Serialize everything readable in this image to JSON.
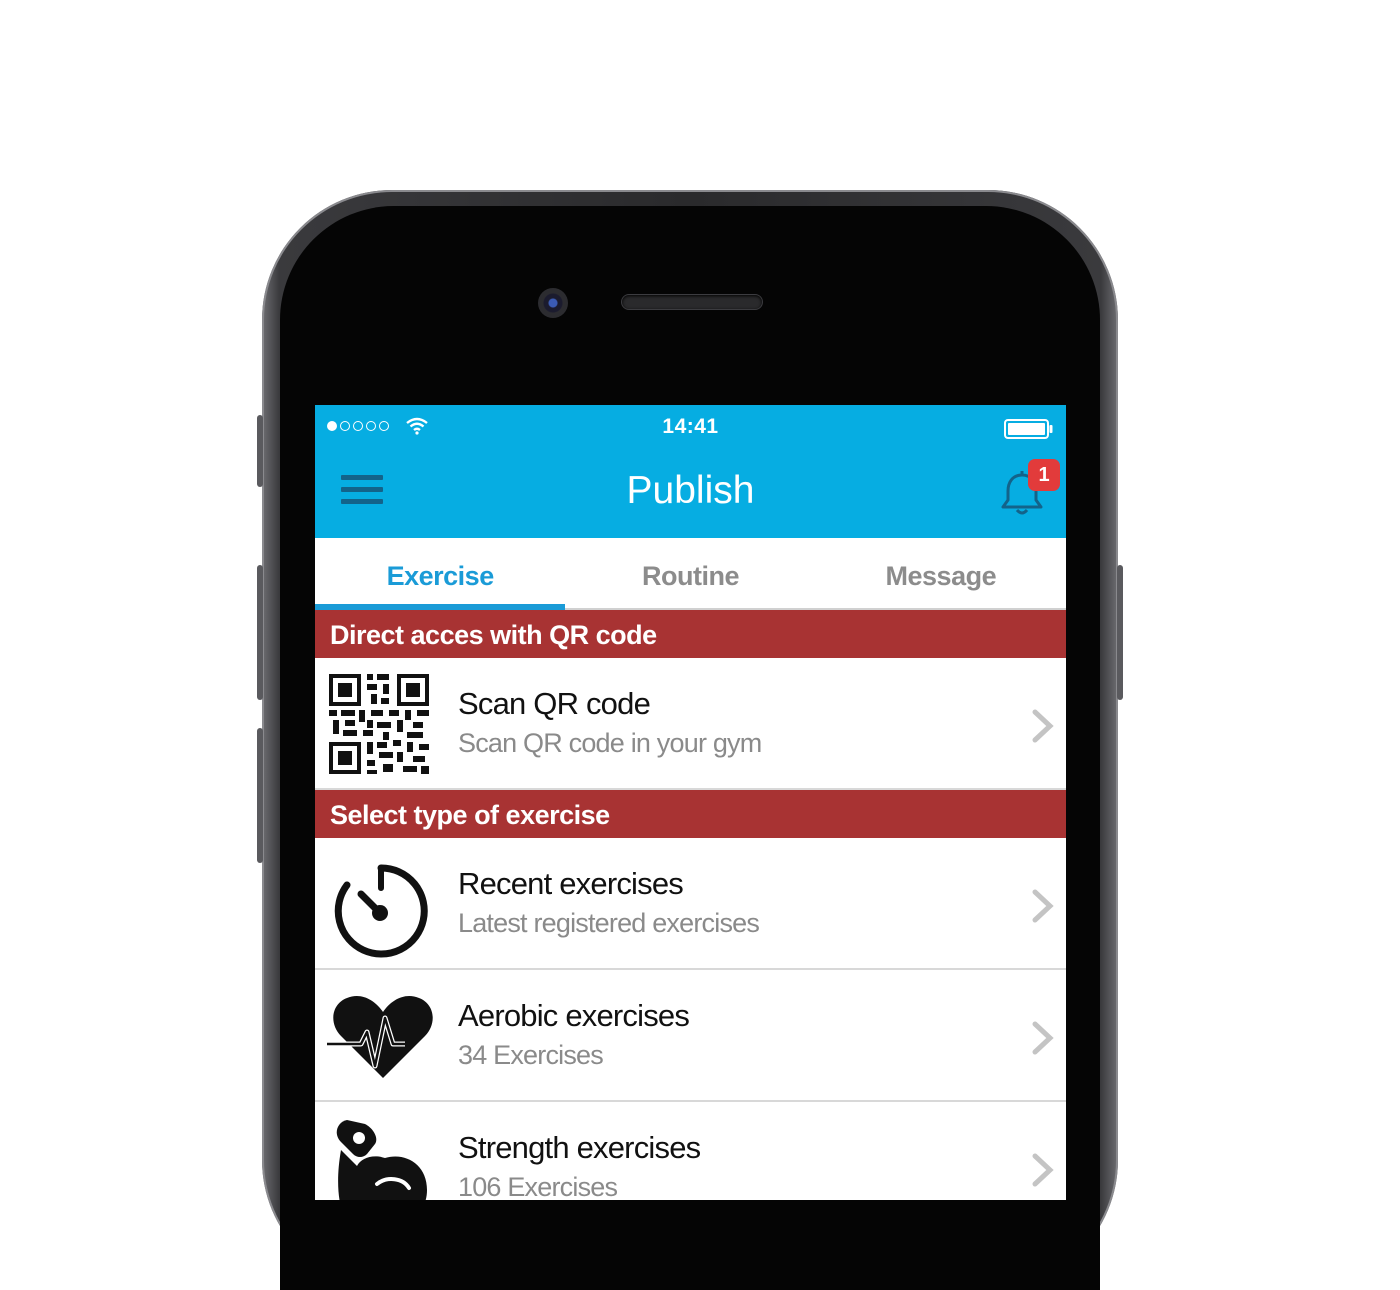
{
  "status_bar": {
    "time": "14:41",
    "signal_bars_filled": 1,
    "signal_bars_total": 5
  },
  "app_bar": {
    "title": "Publish",
    "menu_icon": "hamburger-menu-icon",
    "notification_icon": "bell-icon",
    "notification_count": "1"
  },
  "tabs": [
    {
      "label": "Exercise",
      "active": true
    },
    {
      "label": "Routine",
      "active": false
    },
    {
      "label": "Message",
      "active": false
    }
  ],
  "sections": {
    "qr": {
      "header": "Direct acces with QR code",
      "item": {
        "title": "Scan QR code",
        "subtitle": "Scan QR code in your gym",
        "icon": "qr-code-icon"
      }
    },
    "types": {
      "header": "Select type of exercise",
      "items": [
        {
          "title": "Recent exercises",
          "subtitle": "Latest registered exercises",
          "icon": "stopwatch-icon"
        },
        {
          "title": "Aerobic exercises",
          "subtitle": "34 Exercises",
          "icon": "heartbeat-icon"
        },
        {
          "title": "Strength exercises",
          "subtitle": "106 Exercises",
          "icon": "flexed-arm-icon"
        }
      ]
    }
  },
  "colors": {
    "app_bar": "#06ade2",
    "section_header": "#a83333",
    "tab_active": "#1a9bd7",
    "tab_inactive": "#8c8c8c",
    "badge": "#e23b3b"
  }
}
